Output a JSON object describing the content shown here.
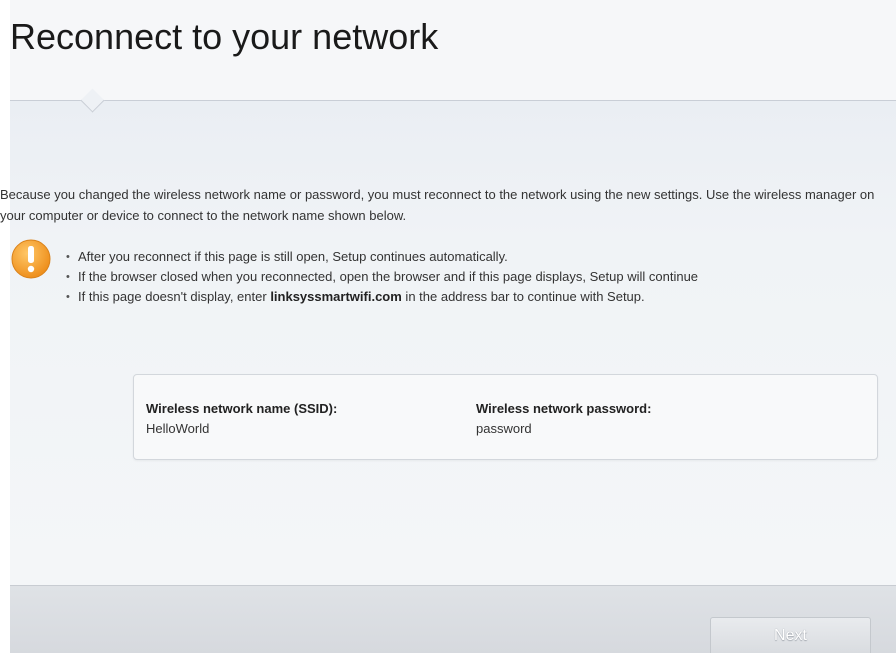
{
  "page": {
    "title": "Reconnect to your network",
    "intro": "Because you changed the wireless network name or password, you must reconnect to the network using the new settings. Use the wireless manager on your computer or device to connect to the network name shown below.",
    "warning_icon": "exclamation-icon",
    "bullets": [
      {
        "text": "After you reconnect if this page is still open, Setup continues automatically."
      },
      {
        "text": "If the browser closed when you reconnected, open the browser and if this page displays, Setup will continue"
      },
      {
        "before": "If this page doesn't display, enter ",
        "bold": "linksyssmartwifi.com",
        "after": " in the address bar to continue with Setup."
      }
    ]
  },
  "network": {
    "ssid_label": "Wireless network name (SSID):",
    "ssid_value": "HelloWorld",
    "password_label": "Wireless network password:",
    "password_value": "password"
  },
  "footer": {
    "next_label": "Next",
    "next_enabled": false
  },
  "colors": {
    "warning": "#f7a531",
    "content_bg": "#eef1f5",
    "footer_bg": "#dbdee2"
  }
}
